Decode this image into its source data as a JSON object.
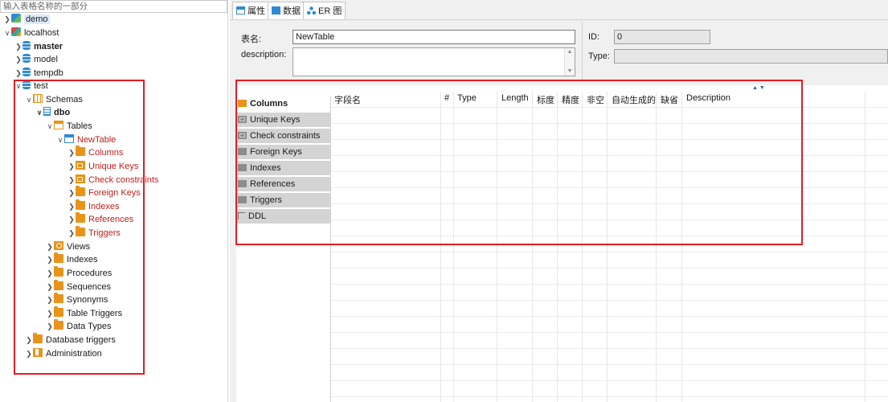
{
  "filter": {
    "placeholder": "输入表格名称的一部分"
  },
  "tree": {
    "demo": "demo",
    "localhost": "localhost",
    "master": "master",
    "model": "model",
    "tempdb": "tempdb",
    "test": "test",
    "schemas": "Schemas",
    "dbo": "dbo",
    "tables": "Tables",
    "newtable": "NewTable",
    "columns": "Columns",
    "unique_keys": "Unique Keys",
    "check_constraints": "Check constraints",
    "foreign_keys": "Foreign Keys",
    "indexes": "Indexes",
    "references": "References",
    "triggers": "Triggers",
    "views": "Views",
    "schema_indexes": "Indexes",
    "procedures": "Procedures",
    "sequences": "Sequences",
    "synonyms": "Synonyms",
    "table_triggers": "Table Triggers",
    "data_types": "Data Types",
    "database_triggers": "Database triggers",
    "administration": "Administration"
  },
  "editor_tabs": [
    "属性",
    "数据",
    "ER 图"
  ],
  "properties": {
    "table_name_label": "表名:",
    "table_name_value": "NewTable",
    "description_label": "description:",
    "description_value": "",
    "id_label": "ID:",
    "id_value": "0",
    "type_label": "Type:",
    "type_value": ""
  },
  "side_tabs": [
    "Columns",
    "Unique Keys",
    "Check constraints",
    "Foreign Keys",
    "Indexes",
    "References",
    "Triggers",
    "DDL"
  ],
  "columns_header": [
    "字段名",
    "#",
    "Type",
    "Length",
    "标度",
    "精度",
    "非空",
    "自动生成的",
    "缺省",
    "Description"
  ],
  "colors": {
    "accent": "#2e8bd4",
    "folder": "#e8941a",
    "highlight_box": "#e51c23",
    "selected_text": "#c0201c"
  }
}
